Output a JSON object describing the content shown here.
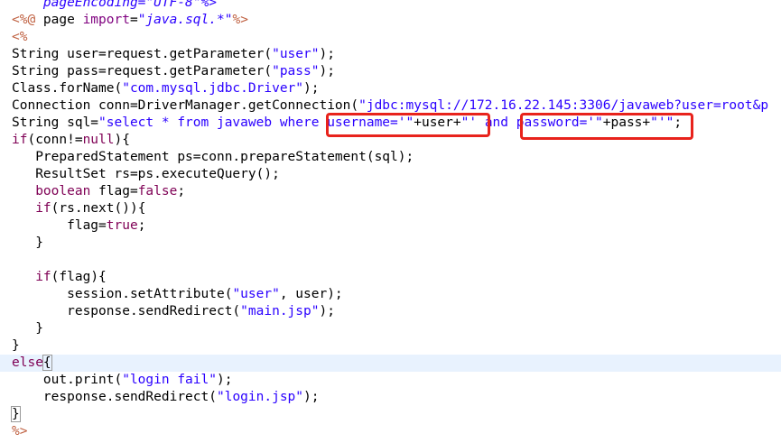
{
  "editor": {
    "lines": [
      {
        "tokens": [
          {
            "t": "    pageEncoding=\"UTF-8\"%>",
            "c": "tok-attrval"
          }
        ]
      },
      {
        "tokens": [
          {
            "t": "<%@ ",
            "c": "tok-jsp"
          },
          {
            "t": "page ",
            "c": "tok-def"
          },
          {
            "t": "import",
            "c": "tok-attr"
          },
          {
            "t": "=",
            "c": "tok-def"
          },
          {
            "t": "\"java.sql.*\"",
            "c": "tok-attrval"
          },
          {
            "t": "%>",
            "c": "tok-jsp"
          }
        ]
      },
      {
        "tokens": [
          {
            "t": "<%",
            "c": "tok-jsp"
          }
        ]
      },
      {
        "tokens": [
          {
            "t": "String user=request.getParameter(",
            "c": "tok-def"
          },
          {
            "t": "\"user\"",
            "c": "tok-str"
          },
          {
            "t": ");",
            "c": "tok-def"
          }
        ]
      },
      {
        "tokens": [
          {
            "t": "String pass=request.getParameter(",
            "c": "tok-def"
          },
          {
            "t": "\"pass\"",
            "c": "tok-str"
          },
          {
            "t": ");",
            "c": "tok-def"
          }
        ]
      },
      {
        "tokens": [
          {
            "t": "Class.forName(",
            "c": "tok-def"
          },
          {
            "t": "\"com.mysql.jdbc.Driver\"",
            "c": "tok-str"
          },
          {
            "t": ");",
            "c": "tok-def"
          }
        ]
      },
      {
        "tokens": [
          {
            "t": "Connection conn=DriverManager.getConnection(",
            "c": "tok-def"
          },
          {
            "t": "\"jdbc:mysql://172.16.22.145:3306/javaweb?user=root&p",
            "c": "tok-str"
          }
        ]
      },
      {
        "tokens": [
          {
            "t": "String sql=",
            "c": "tok-def"
          },
          {
            "t": "\"select * from javaweb where username='\"",
            "c": "tok-str"
          },
          {
            "t": "+user+",
            "c": "tok-def"
          },
          {
            "t": "\"' and password='\"",
            "c": "tok-str"
          },
          {
            "t": "+pass+",
            "c": "tok-def"
          },
          {
            "t": "\"'\"",
            "c": "tok-str"
          },
          {
            "t": ";",
            "c": "tok-def"
          }
        ]
      },
      {
        "tokens": [
          {
            "t": "if",
            "c": "tok-kw"
          },
          {
            "t": "(conn!=",
            "c": "tok-def"
          },
          {
            "t": "null",
            "c": "tok-kw"
          },
          {
            "t": "){",
            "c": "tok-def"
          }
        ]
      },
      {
        "tokens": [
          {
            "t": "   PreparedStatement ps=conn.prepareStatement(sql);",
            "c": "tok-def"
          }
        ]
      },
      {
        "tokens": [
          {
            "t": "   ResultSet rs=ps.executeQuery();",
            "c": "tok-def"
          }
        ]
      },
      {
        "tokens": [
          {
            "t": "   ",
            "c": "tok-def"
          },
          {
            "t": "boolean",
            "c": "tok-kw"
          },
          {
            "t": " flag=",
            "c": "tok-def"
          },
          {
            "t": "false",
            "c": "tok-kw"
          },
          {
            "t": ";",
            "c": "tok-def"
          }
        ]
      },
      {
        "tokens": [
          {
            "t": "   ",
            "c": "tok-def"
          },
          {
            "t": "if",
            "c": "tok-kw"
          },
          {
            "t": "(rs.next()){",
            "c": "tok-def"
          }
        ]
      },
      {
        "tokens": [
          {
            "t": "       flag=",
            "c": "tok-def"
          },
          {
            "t": "true",
            "c": "tok-kw"
          },
          {
            "t": ";",
            "c": "tok-def"
          }
        ]
      },
      {
        "tokens": [
          {
            "t": "   }",
            "c": "tok-def"
          }
        ]
      },
      {
        "tokens": []
      },
      {
        "tokens": [
          {
            "t": "   ",
            "c": "tok-def"
          },
          {
            "t": "if",
            "c": "tok-kw"
          },
          {
            "t": "(flag){",
            "c": "tok-def"
          }
        ]
      },
      {
        "tokens": [
          {
            "t": "       session.setAttribute(",
            "c": "tok-def"
          },
          {
            "t": "\"user\"",
            "c": "tok-str"
          },
          {
            "t": ", user);",
            "c": "tok-def"
          }
        ]
      },
      {
        "tokens": [
          {
            "t": "       response.sendRedirect(",
            "c": "tok-def"
          },
          {
            "t": "\"main.jsp\"",
            "c": "tok-str"
          },
          {
            "t": ");",
            "c": "tok-def"
          }
        ]
      },
      {
        "tokens": [
          {
            "t": "   }",
            "c": "tok-def"
          }
        ]
      },
      {
        "tokens": [
          {
            "t": "}",
            "c": "tok-def"
          }
        ]
      },
      {
        "current": true,
        "tokens": [
          {
            "t": "else",
            "c": "tok-kw"
          },
          {
            "t": "{",
            "c": "tok-def",
            "box": true
          },
          {
            "caret": true
          }
        ]
      },
      {
        "tokens": [
          {
            "t": "    out.print(",
            "c": "tok-def"
          },
          {
            "t": "\"login fail\"",
            "c": "tok-str"
          },
          {
            "t": ");",
            "c": "tok-def"
          }
        ]
      },
      {
        "tokens": [
          {
            "t": "    response.sendRedirect(",
            "c": "tok-def"
          },
          {
            "t": "\"login.jsp\"",
            "c": "tok-str"
          },
          {
            "t": ");",
            "c": "tok-def"
          }
        ]
      },
      {
        "tokens": [
          {
            "t": "}",
            "c": "tok-def",
            "box": true
          }
        ]
      },
      {
        "tokens": [
          {
            "t": "%>",
            "c": "tok-jsp"
          }
        ]
      }
    ]
  },
  "highlights": [
    {
      "label": "username-highlight"
    },
    {
      "label": "password-highlight"
    }
  ],
  "colors": {
    "keyword": "#7f0055",
    "string": "#2a00ff",
    "jsp_delimiter": "#bf5f3f",
    "annotation": "#e8231c",
    "current_line": "#e8f2fe"
  }
}
